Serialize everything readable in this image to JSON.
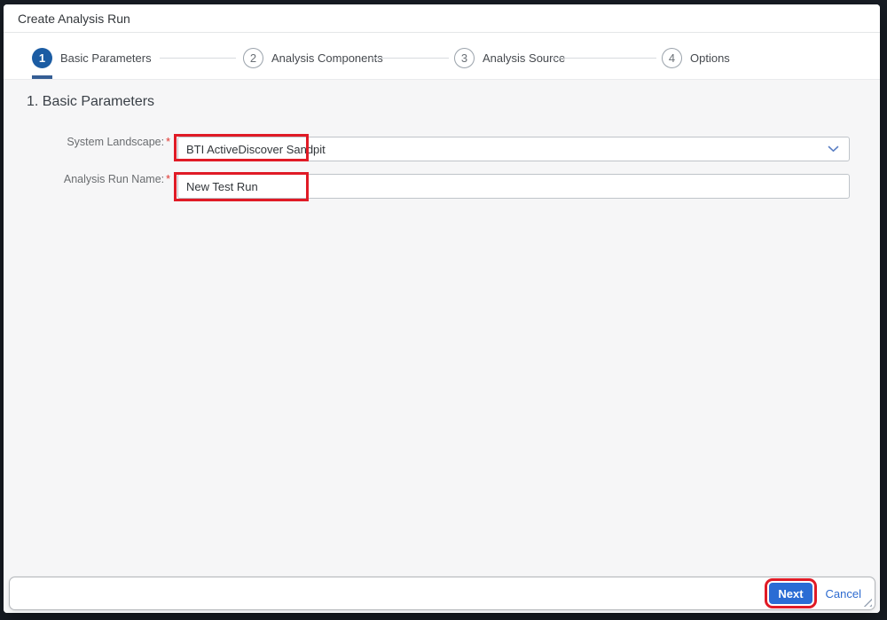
{
  "window": {
    "title": "Create Analysis Run"
  },
  "wizard": {
    "steps": [
      {
        "number": "1",
        "label": "Basic Parameters",
        "state": "active"
      },
      {
        "number": "2",
        "label": "Analysis Components",
        "state": "upcoming"
      },
      {
        "number": "3",
        "label": "Analysis Source",
        "state": "upcoming"
      },
      {
        "number": "4",
        "label": "Options",
        "state": "upcoming"
      }
    ]
  },
  "content": {
    "section_heading": "1. Basic Parameters",
    "fields": [
      {
        "label": "System Landscape:",
        "required_marker": "*",
        "value": "BTI ActiveDiscover Sandpit",
        "control": "select",
        "icon": "chevron-down-icon"
      },
      {
        "label": "Analysis Run Name:",
        "required_marker": "*",
        "value": "New Test Run",
        "control": "text-input"
      }
    ]
  },
  "footer": {
    "next_label": "Next",
    "cancel_label": "Cancel"
  },
  "annotations": {
    "color": "#e01b26",
    "highlighted_elements": [
      "system-landscape-value",
      "analysis-run-name-value",
      "next-button"
    ]
  },
  "colors": {
    "active_step_blue": "#1b5ca3",
    "step_underline_blue": "#355e94",
    "primary_button_blue": "#2a6cd4",
    "link_blue": "#2e6bd0",
    "annotation_red": "#e01b26",
    "content_background": "#f6f6f7",
    "overlay_dark": "#181d25",
    "required_red": "#e0352f"
  }
}
